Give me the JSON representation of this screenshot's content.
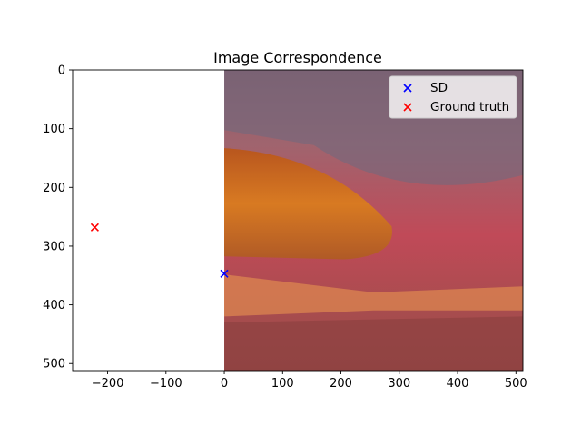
{
  "chart_data": {
    "type": "scatter",
    "title": "Image Correspondence",
    "xlabel": "",
    "ylabel": "",
    "xlim": [
      -260,
      512
    ],
    "ylim": [
      512,
      0
    ],
    "y_inverted": true,
    "xticks": [
      -200,
      -100,
      0,
      100,
      200,
      300,
      400,
      500
    ],
    "xtick_labels": [
      "−200",
      "−100",
      "0",
      "100",
      "200",
      "300",
      "400",
      "500"
    ],
    "yticks": [
      0,
      100,
      200,
      300,
      400,
      500
    ],
    "ytick_labels": [
      "0",
      "100",
      "200",
      "300",
      "400",
      "500"
    ],
    "grid": false,
    "background_image": {
      "extent_x": [
        0,
        512
      ],
      "extent_y": [
        0,
        512
      ],
      "description_colors": {
        "top": "#8a5a66",
        "mid": "#c24a56",
        "orange": "#d8781c",
        "bottom": "#9a4848"
      }
    },
    "series": [
      {
        "name": "SD",
        "marker": "x",
        "color": "#0000ff",
        "points": [
          {
            "x": 0,
            "y": 347
          }
        ]
      },
      {
        "name": "Ground truth",
        "marker": "x",
        "color": "#ff0000",
        "points": [
          {
            "x": -222,
            "y": 268
          }
        ]
      }
    ],
    "legend_placement": "top-right"
  }
}
